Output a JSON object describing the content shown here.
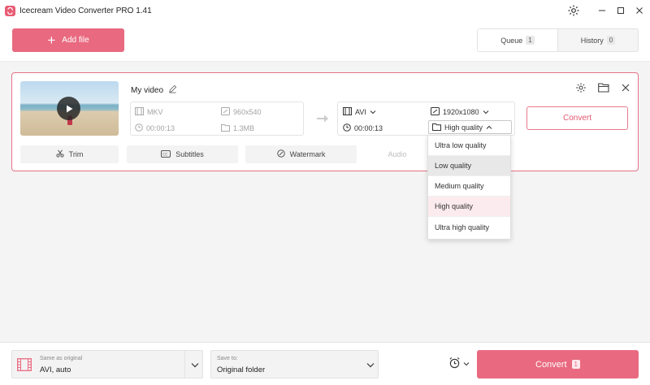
{
  "window": {
    "title": "Icecream Video Converter PRO 1.41"
  },
  "toolbar": {
    "add_file_label": "Add file"
  },
  "tabs": [
    {
      "label": "Queue",
      "count": "1"
    },
    {
      "label": "History",
      "count": "0"
    }
  ],
  "task": {
    "name": "My video",
    "source": {
      "format": "MKV",
      "resolution": "960x540",
      "duration": "00:00:13",
      "size": "1.3MB"
    },
    "target": {
      "format": "AVI",
      "resolution": "1920x1080",
      "duration": "00:00:13",
      "quality": "High quality"
    },
    "convert_label": "Convert",
    "actions": {
      "trim": "Trim",
      "subtitles": "Subtitles",
      "watermark": "Watermark",
      "audio": "Audio"
    }
  },
  "quality_menu": {
    "options": [
      "Ultra low quality",
      "Low quality",
      "Medium quality",
      "High quality",
      "Ultra high quality"
    ],
    "hovered": "Low quality",
    "selected": "High quality"
  },
  "bottom": {
    "format_label": "Same as original",
    "format_value": "AVI, auto",
    "save_label": "Save to:",
    "save_value": "Original folder",
    "convert_label": "Convert",
    "convert_count": "1"
  },
  "colors": {
    "accent": "#e96a80",
    "accent_text": "#e0566e",
    "selected_bg": "#fcebee"
  }
}
